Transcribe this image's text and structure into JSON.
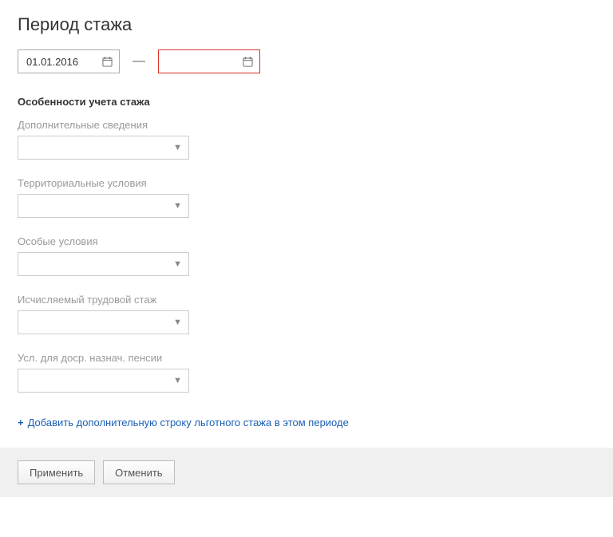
{
  "title": "Период стажа",
  "date_from": "01.01.2016",
  "date_to": "",
  "dash": "—",
  "section_title": "Особенности учета стажа",
  "fields": {
    "additional_info": {
      "label": "Дополнительные сведения"
    },
    "territorial": {
      "label": "Территориальные условия"
    },
    "special": {
      "label": "Особые условия"
    },
    "calculated": {
      "label": "Исчисляемый трудовой стаж"
    },
    "early_pension": {
      "label": "Усл. для доср. назнач. пенсии"
    }
  },
  "add_link": "Добавить дополнительную строку льготного стажа в этом периоде",
  "buttons": {
    "apply": "Применить",
    "cancel": "Отменить"
  }
}
